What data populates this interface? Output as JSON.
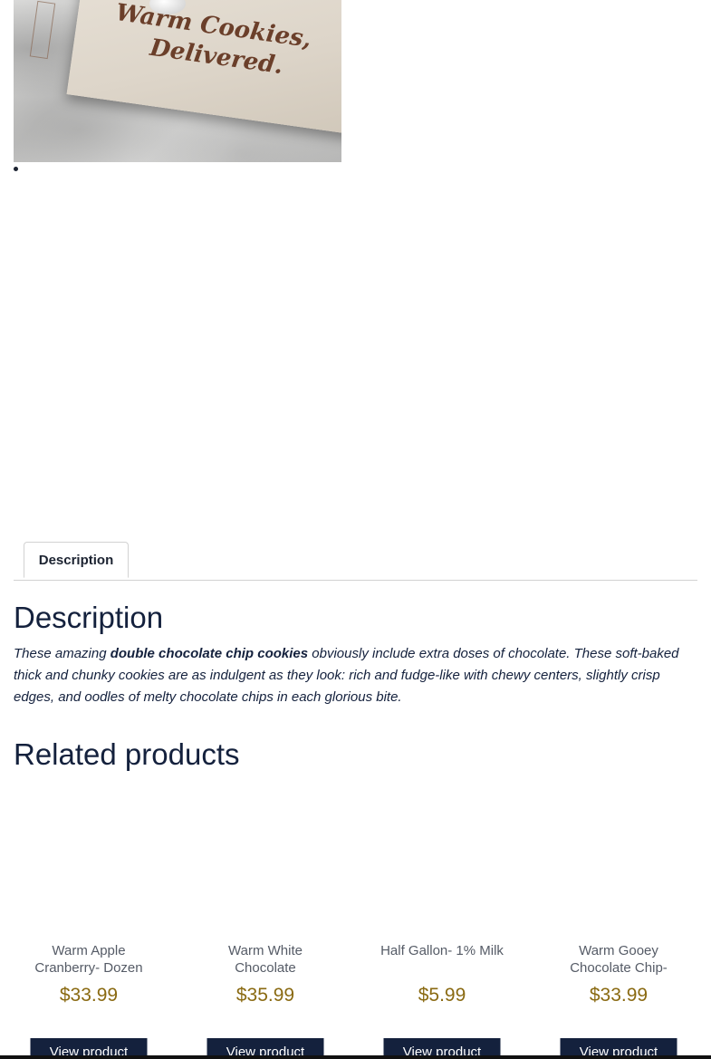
{
  "product_image": {
    "alt_text_visible": "",
    "box_line1": "Warm Cookies,",
    "box_line2": "Delivered."
  },
  "tabs": [
    {
      "label": "Description",
      "active": true
    }
  ],
  "description": {
    "heading": "Description",
    "text_before": "These amazing ",
    "text_bold": "double chocolate chip cookies",
    "text_after": " obviously include extra doses of chocolate. These soft-baked thick and chunky cookies are as indulgent as they look: rich and fudge-like with chewy centers, slightly crisp edges, and oodles of melty chocolate chips in each glorious bite."
  },
  "related": {
    "heading": "Related products",
    "items": [
      {
        "title": "Warm Apple Cranberry- Dozen",
        "price": "$33.99",
        "button": "View product"
      },
      {
        "title": "Warm White Chocolate",
        "price": "$35.99",
        "button": "View product"
      },
      {
        "title": "Half Gallon- 1% Milk",
        "price": "$5.99",
        "button": "View product"
      },
      {
        "title": "Warm Gooey Chocolate Chip-",
        "price": "$33.99",
        "button": "View product"
      }
    ]
  },
  "colors": {
    "text": "#14213d",
    "price": "#8a6a12",
    "button_bg": "#14213d",
    "button_text": "#ffffff",
    "border": "#d2d2d2"
  }
}
